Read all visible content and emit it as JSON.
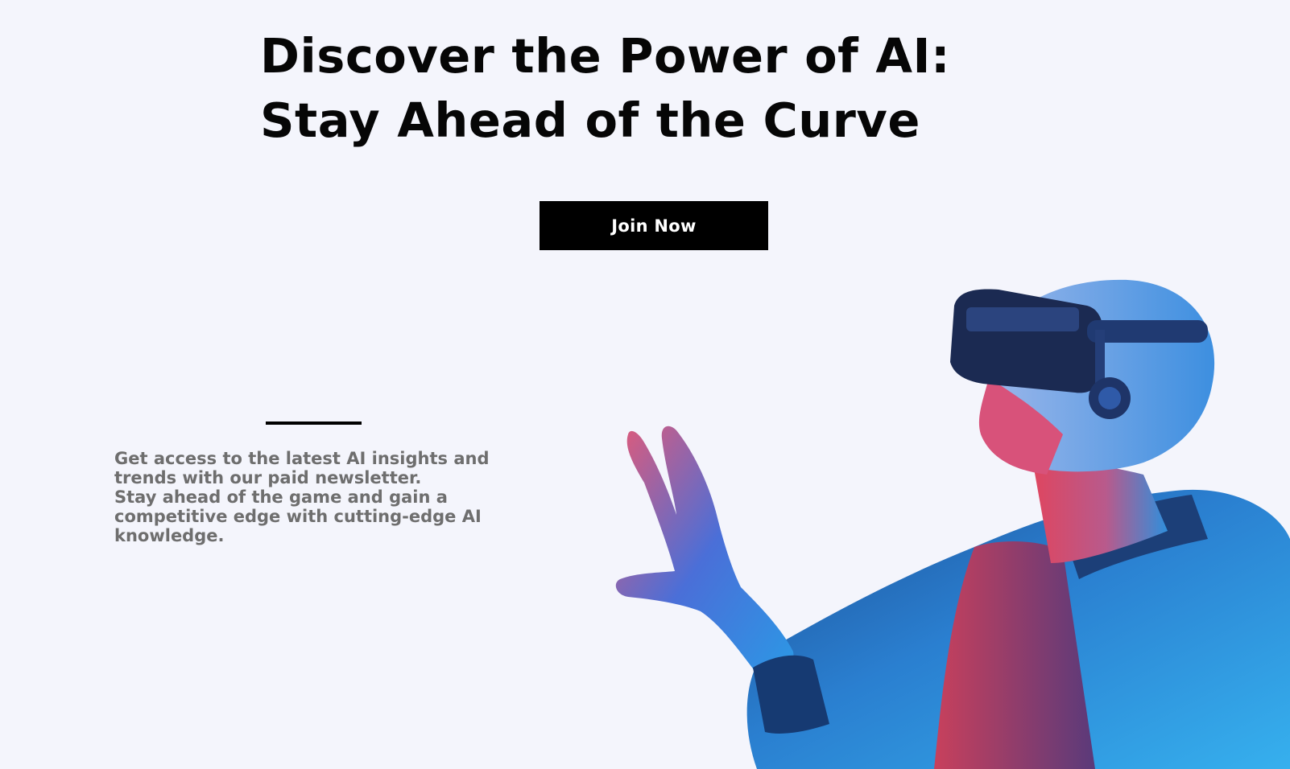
{
  "hero": {
    "title_line1": "Discover the Power of AI:",
    "title_line2": "Stay Ahead of the Curve",
    "cta_label": "Join Now"
  },
  "description": {
    "line1": "Get access to the latest AI insights and",
    "line2": "trends with our paid newsletter.",
    "line3": "Stay ahead of the game and gain a",
    "line4": "competitive edge with cutting-edge AI",
    "line5": "knowledge."
  },
  "image": {
    "subject": "man-wearing-vr-headset-icon"
  },
  "colors": {
    "background": "#f4f5fc",
    "title": "#060606",
    "button_bg": "#000000",
    "button_text": "#ffffff",
    "body_text": "#6e6e6e",
    "image_blue": "#1f8fe0",
    "image_pink": "#e0455e"
  }
}
